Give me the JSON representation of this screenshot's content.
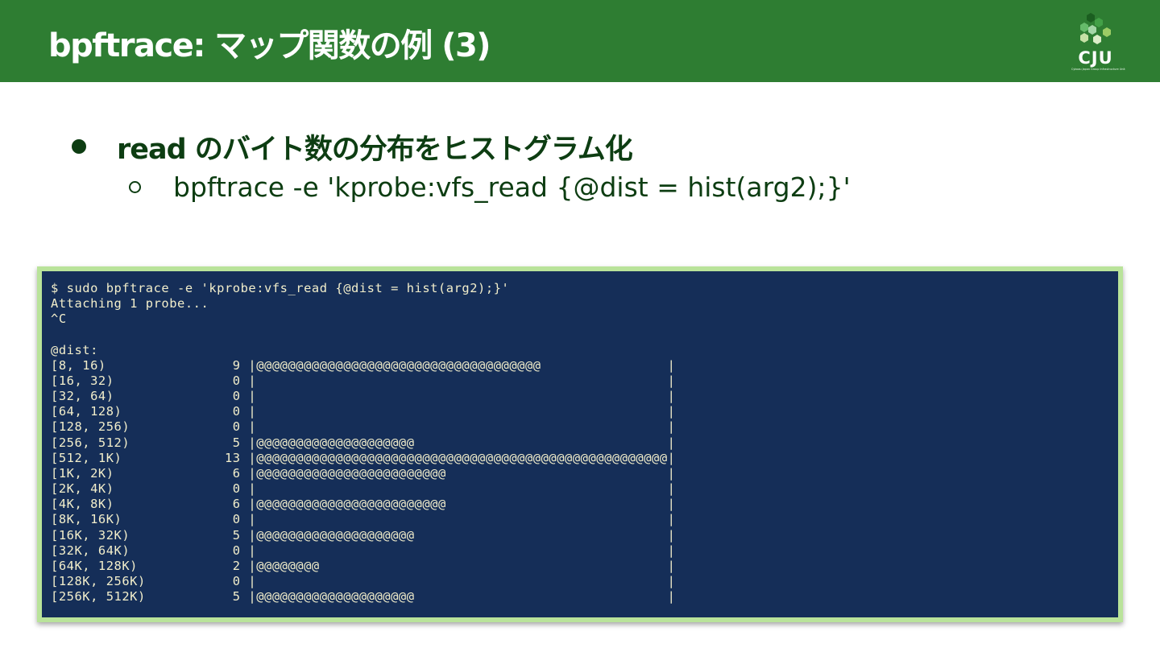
{
  "header": {
    "title": "bpftrace: マップ関数の例 (3)",
    "logo_text": "CJU",
    "logo_tagline": "Cybozu Japan Group Infrastructure Unit",
    "bg_color": "#2e7d32"
  },
  "bullets": {
    "level1": "read のバイト数の分布をヒストグラム化",
    "level2": "bpftrace -e 'kprobe:vfs_read {@dist = hist(arg2);}'"
  },
  "terminal": {
    "bg_color": "#152e58",
    "frame_color": "#b9e39a",
    "text_color": "#f2eecb",
    "lines": [
      "$ sudo bpftrace -e 'kprobe:vfs_read {@dist = hist(arg2);}'",
      "Attaching 1 probe...",
      "^C",
      "",
      "@dist:",
      "[8, 16)                9 |@@@@@@@@@@@@@@@@@@@@@@@@@@@@@@@@@@@@                |",
      "[16, 32)               0 |                                                    |",
      "[32, 64)               0 |                                                    |",
      "[64, 128)              0 |                                                    |",
      "[128, 256)             0 |                                                    |",
      "[256, 512)             5 |@@@@@@@@@@@@@@@@@@@@                                |",
      "[512, 1K)             13 |@@@@@@@@@@@@@@@@@@@@@@@@@@@@@@@@@@@@@@@@@@@@@@@@@@@@|",
      "[1K, 2K)               6 |@@@@@@@@@@@@@@@@@@@@@@@@                            |",
      "[2K, 4K)               0 |                                                    |",
      "[4K, 8K)               6 |@@@@@@@@@@@@@@@@@@@@@@@@                            |",
      "[8K, 16K)              0 |                                                    |",
      "[16K, 32K)             5 |@@@@@@@@@@@@@@@@@@@@                                |",
      "[32K, 64K)             0 |                                                    |",
      "[64K, 128K)            2 |@@@@@@@@                                            |",
      "[128K, 256K)           0 |                                                    |",
      "[256K, 512K)           5 |@@@@@@@@@@@@@@@@@@@@                                |"
    ]
  }
}
